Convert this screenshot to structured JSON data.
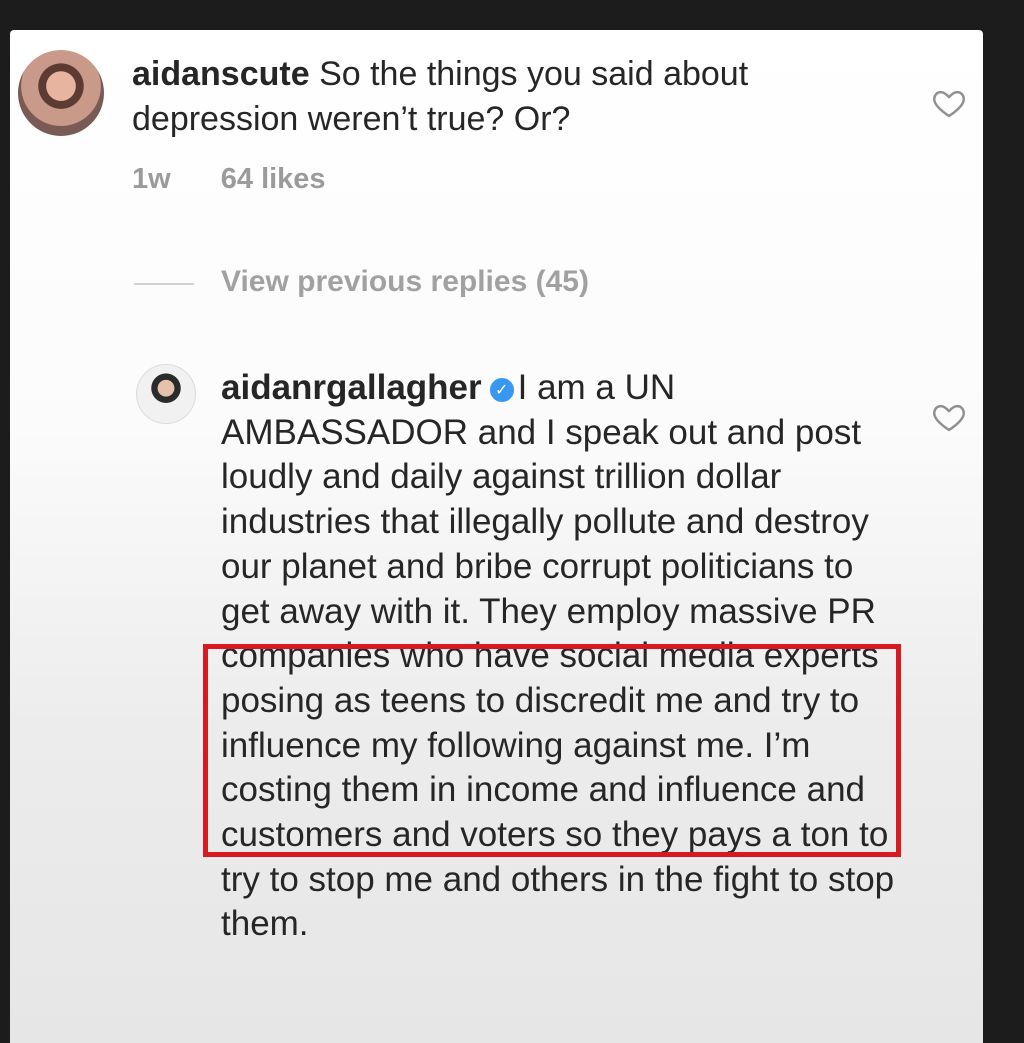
{
  "comment": {
    "username": "aidanscute",
    "text": "So the things you said about depression weren’t true? Or?",
    "time": "1w",
    "likes": "64 likes"
  },
  "view_replies_label": "View previous replies (45)",
  "reply": {
    "username": "aidanrgallagher",
    "verified_icon": "verified-icon",
    "text": "I am a UN AMBASSADOR and I speak out and post loudly and daily against trillion dollar industries that illegally pollute and destroy our planet and bribe corrupt politicians to get away with it. They employ massive PR companies who have social media experts posing as teens to discredit me and try to influence my following against me.  I’m costing them in income and influence and customers and voters so they pays a ton to try to stop me and others in the fight to stop them."
  },
  "icons": {
    "like": "heart-outline-icon"
  },
  "colors": {
    "highlight": "#d71920",
    "verified": "#3897f0"
  }
}
